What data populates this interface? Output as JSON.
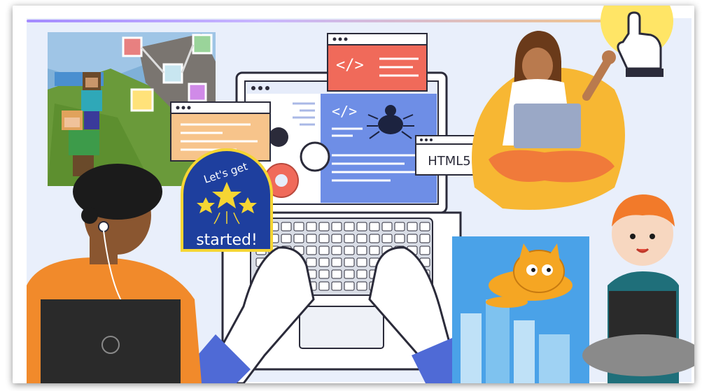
{
  "badge": {
    "line1": "Let's get",
    "line2": "started!"
  },
  "html5_window": {
    "label": "HTML5"
  },
  "code_window": {
    "tag": "</>"
  },
  "laptop_screen": {
    "tag": "</>"
  },
  "colors": {
    "background": "#e9effb",
    "badge_blue": "#1e3f9e",
    "badge_yellow": "#f5d533",
    "code_window_red": "#f06a5a",
    "note_window_orange": "#f7c48b",
    "laptop_screen_blue": "#6e8ee6",
    "scratch_sky": "#4aa2e8",
    "beanbag_yellow": "#f7b733"
  }
}
